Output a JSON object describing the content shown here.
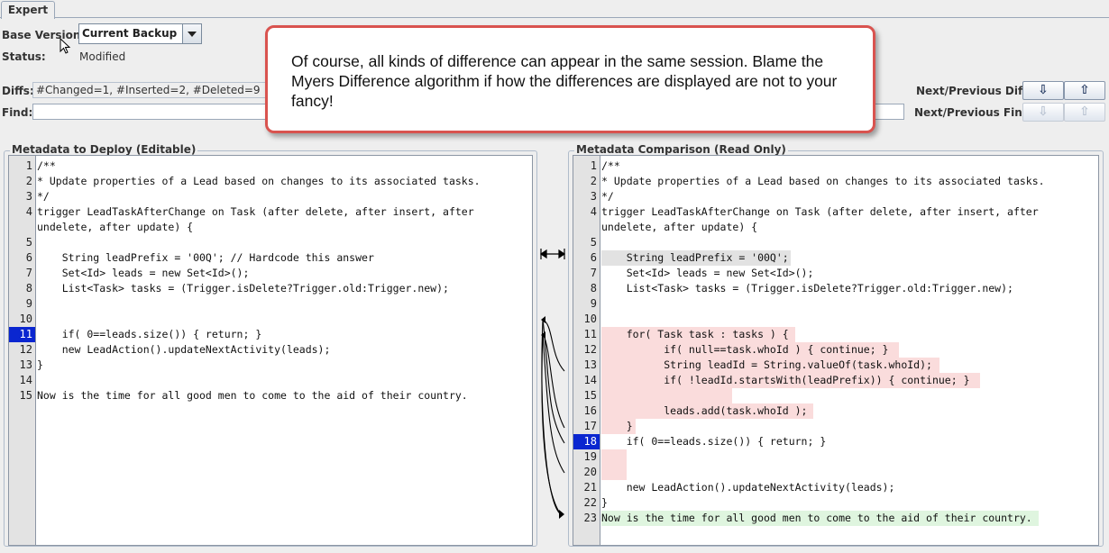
{
  "tabs": {
    "expert": "Expert"
  },
  "base_version": {
    "label": "Base Version:",
    "value": "Current Backup"
  },
  "status": {
    "label": "Status:",
    "value": "Modified"
  },
  "diffs": {
    "label": "Diffs:",
    "value": "#Changed=1, #Inserted=2, #Deleted=9"
  },
  "find": {
    "label": "Find:",
    "value": ""
  },
  "nav": {
    "next_prev_diff_label": "Next/Previous Diff:",
    "next_prev_find_label": "Next/Previous Find:",
    "down_glyph": "⇩",
    "up_glyph": "⇧"
  },
  "callout": {
    "text": "Of course, all kinds of difference can appear in the same session. Blame the Myers Difference algorithm if how the differences are displayed are not to your fancy!"
  },
  "left_panel": {
    "title": "Metadata to Deploy (Editable)",
    "selected_line": 11,
    "lines": [
      {
        "n": "1",
        "text": "/**"
      },
      {
        "n": "2",
        "text": "* Update properties of a Lead based on changes to its associated tasks."
      },
      {
        "n": "3",
        "text": "*/"
      },
      {
        "n": "4",
        "text": "trigger LeadTaskAfterChange on Task (after delete, after insert, after"
      },
      {
        "n": "",
        "text": "undelete, after update) {"
      },
      {
        "n": "5",
        "text": ""
      },
      {
        "n": "6",
        "text": "    String leadPrefix = '00Q'; // Hardcode this answer"
      },
      {
        "n": "7",
        "text": "    Set<Id> leads = new Set<Id>();"
      },
      {
        "n": "8",
        "text": "    List<Task> tasks = (Trigger.isDelete?Trigger.old:Trigger.new);"
      },
      {
        "n": "9",
        "text": ""
      },
      {
        "n": "10",
        "text": ""
      },
      {
        "n": "11",
        "text": "    if( 0==leads.size()) { return; }"
      },
      {
        "n": "12",
        "text": "    new LeadAction().updateNextActivity(leads);"
      },
      {
        "n": "13",
        "text": "}"
      },
      {
        "n": "14",
        "text": ""
      },
      {
        "n": "15",
        "text": "Now is the time for all good men to come to the aid of their country."
      }
    ]
  },
  "right_panel": {
    "title": "Metadata Comparison (Read Only)",
    "selected_line": 18,
    "lines": [
      {
        "n": "1",
        "text": "/**"
      },
      {
        "n": "2",
        "text": "* Update properties of a Lead based on changes to its associated tasks."
      },
      {
        "n": "3",
        "text": "*/"
      },
      {
        "n": "4",
        "text": "trigger LeadTaskAfterChange on Task (after delete, after insert, after"
      },
      {
        "n": "",
        "text": "undelete, after update) {"
      },
      {
        "n": "5",
        "text": ""
      },
      {
        "n": "6",
        "text": "    String leadPrefix = '00Q';"
      },
      {
        "n": "7",
        "text": "    Set<Id> leads = new Set<Id>();"
      },
      {
        "n": "8",
        "text": "    List<Task> tasks = (Trigger.isDelete?Trigger.old:Trigger.new);"
      },
      {
        "n": "9",
        "text": ""
      },
      {
        "n": "10",
        "text": ""
      },
      {
        "n": "11",
        "text": "    for( Task task : tasks ) {"
      },
      {
        "n": "12",
        "text": "          if( null==task.whoId ) { continue; }"
      },
      {
        "n": "13",
        "text": "          String leadId = String.valueOf(task.whoId);"
      },
      {
        "n": "14",
        "text": "          if( !leadId.startsWith(leadPrefix)) { continue; }"
      },
      {
        "n": "15",
        "text": ""
      },
      {
        "n": "16",
        "text": "          leads.add(task.whoId );"
      },
      {
        "n": "17",
        "text": "    }"
      },
      {
        "n": "18",
        "text": "    if( 0==leads.size()) { return; }"
      },
      {
        "n": "19",
        "text": ""
      },
      {
        "n": "20",
        "text": ""
      },
      {
        "n": "21",
        "text": "    new LeadAction().updateNextActivity(leads);"
      },
      {
        "n": "22",
        "text": "}"
      },
      {
        "n": "23",
        "text": "Now is the time for all good men to come to the aid of their country."
      }
    ]
  },
  "colors": {
    "changed": "#e2e2e2",
    "deleted": "#fadcdc",
    "inserted": "#dff5df",
    "selected_line": "#0a26d0",
    "callout_border": "#d9534f"
  }
}
